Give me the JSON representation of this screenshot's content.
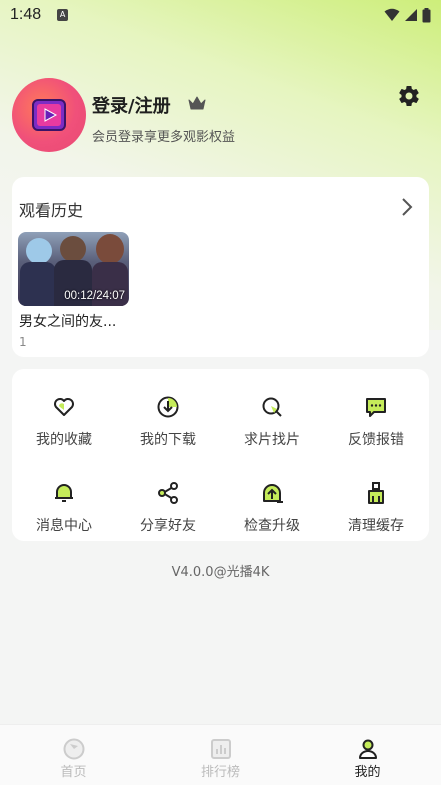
{
  "status_bar": {
    "time": "1:48"
  },
  "profile": {
    "title": "登录/注册",
    "subtitle": "会员登录享更多观影权益"
  },
  "history": {
    "title": "观看历史",
    "items": [
      {
        "title": "男女之间的友...",
        "duration": "00:12/24:07",
        "episode": "1"
      }
    ]
  },
  "menu": [
    {
      "label": "我的收藏",
      "icon": "heart-icon"
    },
    {
      "label": "我的下载",
      "icon": "download-icon"
    },
    {
      "label": "求片找片",
      "icon": "search-film-icon"
    },
    {
      "label": "反馈报错",
      "icon": "feedback-icon"
    },
    {
      "label": "消息中心",
      "icon": "bell-icon"
    },
    {
      "label": "分享好友",
      "icon": "share-icon"
    },
    {
      "label": "检查升级",
      "icon": "upgrade-icon"
    },
    {
      "label": "清理缓存",
      "icon": "clean-icon"
    }
  ],
  "version": "V4.0.0@光播4K",
  "tabs": [
    {
      "label": "首页",
      "icon": "home-icon",
      "active": false
    },
    {
      "label": "排行榜",
      "icon": "ranking-icon",
      "active": false
    },
    {
      "label": "我的",
      "icon": "profile-icon",
      "active": true
    }
  ],
  "colors": {
    "accent": "#c5ec5a",
    "avatar": "#f0507a",
    "background": "#f4f5f4"
  }
}
